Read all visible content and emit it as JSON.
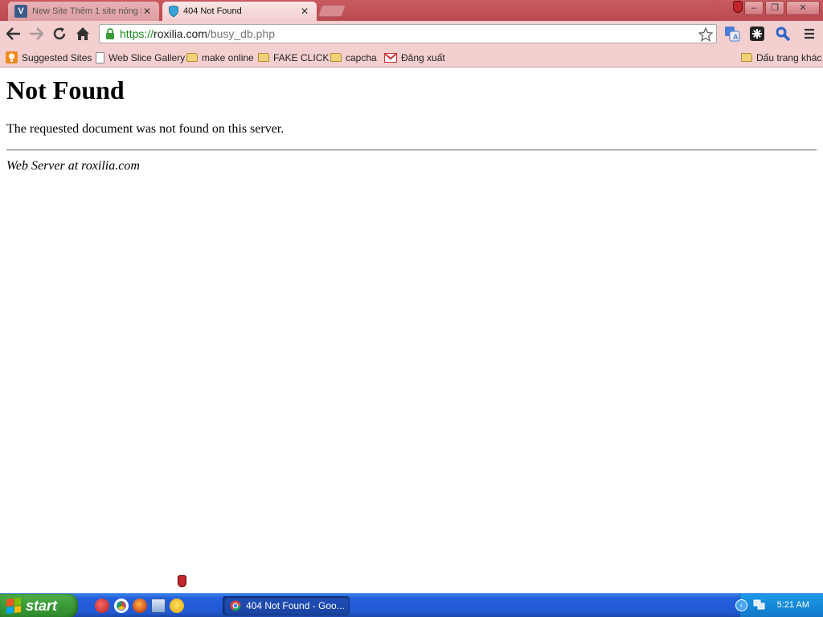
{
  "tabs": [
    {
      "title": "New Site Thêm 1 site nóng h",
      "close": "✕",
      "active": false
    },
    {
      "title": "404 Not Found",
      "close": "✕",
      "active": true
    }
  ],
  "window_controls": {
    "minimize": "–",
    "restore": "❐",
    "close": "✕"
  },
  "toolbar": {
    "url_scheme": "https://",
    "url_host": "roxilia.com",
    "url_path": "/busy_db.php"
  },
  "bookmarks": {
    "items": [
      "Suggested Sites",
      "Web Slice Gallery",
      "make online",
      "FAKE CLICK",
      "capcha",
      "Đăng xuất"
    ],
    "other": "Dấu trang khác"
  },
  "page": {
    "heading": "Not Found",
    "message": "The requested document was not found on this server.",
    "address": "Web Server at roxilia.com"
  },
  "taskbar": {
    "start_label": "start",
    "active_window": "404 Not Found - Goo...",
    "clock": "5:21 AM"
  },
  "colors": {
    "title_bar": "#b84a50",
    "toolbar": "#f3cfd0",
    "taskbar": "#245edb",
    "start_button": "#3a9a36"
  },
  "icons": [
    "back-arrow-icon",
    "forward-arrow-icon",
    "reload-icon",
    "home-icon",
    "lock-icon",
    "star-icon",
    "translate-icon",
    "puzzle-icon",
    "search-icon",
    "menu-icon",
    "folder-icon",
    "gmail-icon",
    "shield-icon",
    "chrome-icon",
    "firefox-icon"
  ]
}
